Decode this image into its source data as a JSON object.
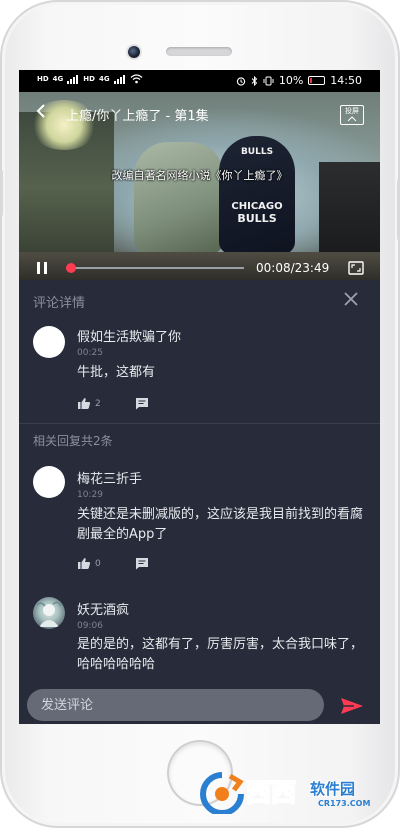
{
  "status_bar": {
    "left_tags": [
      "HD",
      "4G",
      "HD",
      "4G"
    ],
    "battery": "10%",
    "time": "14:50"
  },
  "video": {
    "title": "上瘾/你丫上瘾了 - 第1集",
    "cast_label": "投屏",
    "subtitle": "改编自著名网络小说《你丫上瘾了》",
    "scene_text": {
      "bulls_top": "BULLS",
      "chicago": "CHICAGO",
      "bulls": "BULLS"
    },
    "time_display": "00:08/23:49",
    "progress": 0.0056
  },
  "panel": {
    "title": "评论详情",
    "main_comment": {
      "user": "假如生活欺骗了你",
      "time": "00:25",
      "text": "牛批，这都有",
      "likes": "2"
    },
    "replies_label": "相关回复共2条",
    "replies": [
      {
        "user": "梅花三折手",
        "time": "10:29",
        "text": "关键还是未删减版的，这应该是我目前找到的看腐剧最全的App了",
        "likes": "0"
      },
      {
        "user": "妖无酒疯",
        "time": "09:06",
        "text": "是的是的，这都有了，厉害厉害，太合我口味了，哈哈哈哈哈哈"
      }
    ]
  },
  "input": {
    "placeholder": "发送评论"
  },
  "colors": {
    "accent": "#ff3b53",
    "panel_bg": "#272b3a",
    "send": "#ff3b53"
  },
  "watermark": {
    "text": "西西",
    "text2": "软件园",
    "url": "CR173.COM"
  }
}
